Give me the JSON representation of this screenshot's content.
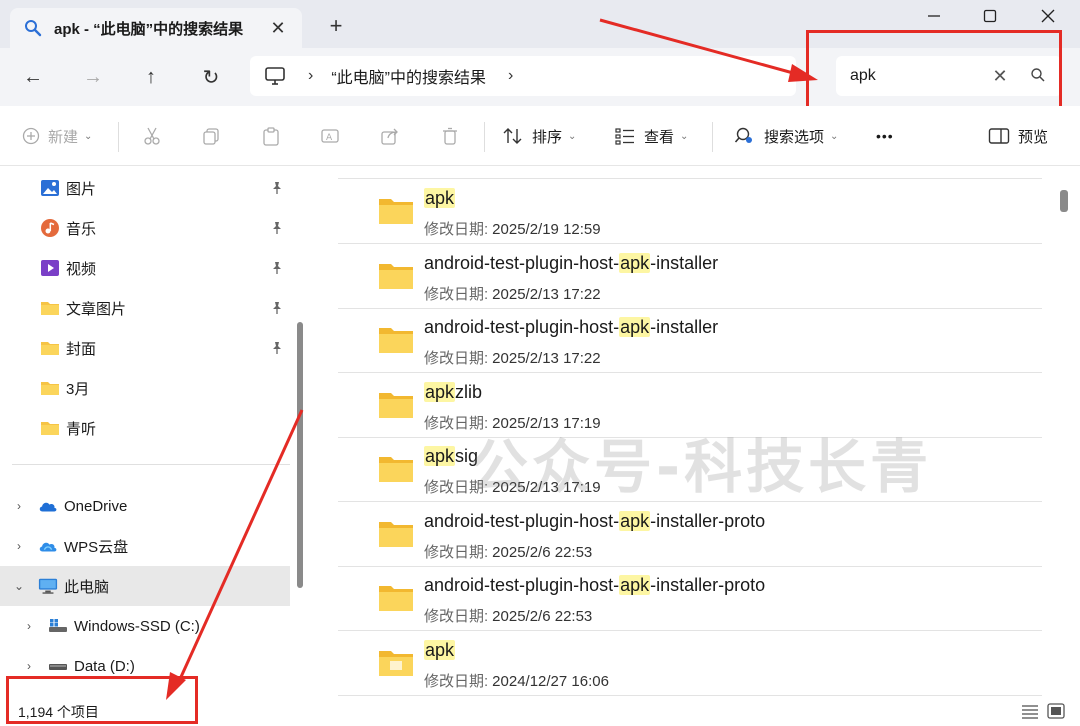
{
  "window": {
    "tab_title": "apk - “此电脑”中的搜索结果",
    "tab_close_icon": "close-icon",
    "new_tab_label": "+",
    "controls": {
      "minimize": "—",
      "maximize": "☐",
      "close": "✕"
    }
  },
  "nav": {
    "back": "←",
    "forward": "→",
    "up": "↑",
    "refresh": "↻",
    "breadcrumb_sep": "›",
    "breadcrumb": "“此电脑”中的搜索结果",
    "breadcrumb_more": "›"
  },
  "search": {
    "value": "apk",
    "clear": "✕"
  },
  "toolbar": {
    "new_label": "新建",
    "sort_label": "排序",
    "view_label": "查看",
    "search_options_label": "搜索选项",
    "more_label": "•••",
    "preview_label": "预览"
  },
  "sidebar": {
    "quick": [
      {
        "label": "图片",
        "icon": "pictures-icon",
        "pinned": true
      },
      {
        "label": "音乐",
        "icon": "music-icon",
        "pinned": true
      },
      {
        "label": "视频",
        "icon": "videos-icon",
        "pinned": true
      },
      {
        "label": "文章图片",
        "icon": "folder-icon",
        "pinned": true
      },
      {
        "label": "封面",
        "icon": "folder-icon",
        "pinned": true
      },
      {
        "label": "3月",
        "icon": "folder-icon",
        "pinned": false
      },
      {
        "label": "青听",
        "icon": "folder-icon",
        "pinned": false
      }
    ],
    "tree": [
      {
        "label": "OneDrive",
        "icon": "onedrive-icon",
        "chevron": "›",
        "expanded": false
      },
      {
        "label": "WPS云盘",
        "icon": "wps-cloud-icon",
        "chevron": "›",
        "expanded": false
      },
      {
        "label": "此电脑",
        "icon": "this-pc-icon",
        "chevron": "⌄",
        "expanded": true
      },
      {
        "label": "Windows-SSD (C:)",
        "icon": "drive-c-icon",
        "chevron": "›",
        "expanded": false
      },
      {
        "label": "Data (D:)",
        "icon": "drive-icon",
        "chevron": "›",
        "expanded": false
      }
    ]
  },
  "results": {
    "meta_label": "修改日期:",
    "items": [
      {
        "pre": "",
        "hl": "apk",
        "post": "",
        "date": "2025/2/19 12:59"
      },
      {
        "pre": "android-test-plugin-host-",
        "hl": "apk",
        "post": "-installer",
        "date": "2025/2/13 17:22"
      },
      {
        "pre": "android-test-plugin-host-",
        "hl": "apk",
        "post": "-installer",
        "date": "2025/2/13 17:22"
      },
      {
        "pre": "",
        "hl": "apk",
        "post": "zlib",
        "date": "2025/2/13 17:19"
      },
      {
        "pre": "",
        "hl": "apk",
        "post": "sig",
        "date": "2025/2/13 17:19"
      },
      {
        "pre": "android-test-plugin-host-",
        "hl": "apk",
        "post": "-installer-proto",
        "date": "2025/2/6 22:53"
      },
      {
        "pre": "android-test-plugin-host-",
        "hl": "apk",
        "post": "-installer-proto",
        "date": "2025/2/6 22:53"
      },
      {
        "pre": "",
        "hl": "apk",
        "post": "",
        "date": "2024/12/27 16:06"
      }
    ]
  },
  "watermark": "公众号-科技长青",
  "status": {
    "count": "1,194 个项目"
  },
  "colors": {
    "highlight": "#fdf6a3",
    "annotation": "#e42b25",
    "folder": "#f6c445"
  }
}
